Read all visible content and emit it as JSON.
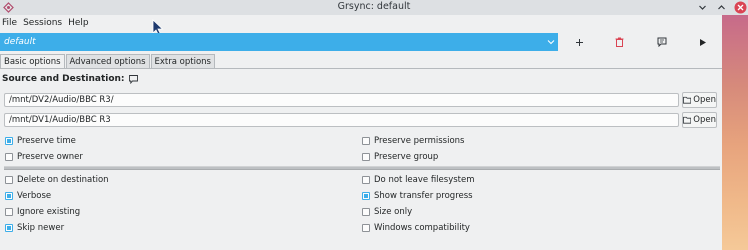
{
  "window": {
    "title": "Grsync: default",
    "controls": [
      "chevron-down-icon",
      "chevron-up-icon",
      "close-icon"
    ]
  },
  "menubar": {
    "items": [
      "File",
      "Sessions",
      "Help"
    ]
  },
  "session": {
    "selected": "default",
    "toolbar_icons": [
      "add-icon",
      "delete-icon",
      "comment-icon",
      "play-icon"
    ]
  },
  "tabs": [
    {
      "label": "Basic options",
      "active": true
    },
    {
      "label": "Advanced options",
      "active": false
    },
    {
      "label": "Extra options",
      "active": false
    }
  ],
  "source_destination": {
    "title": "Source and Destination:",
    "source_path": "/mnt/DV2/Audio/BBC R3/",
    "destination_path": "/mnt/DV1/Audio/BBC R3",
    "open_label": "Open"
  },
  "options_top": [
    {
      "label": "Preserve time",
      "checked": true
    },
    {
      "label": "Preserve permissions",
      "checked": false
    },
    {
      "label": "Preserve owner",
      "checked": false
    },
    {
      "label": "Preserve group",
      "checked": false
    }
  ],
  "options_bottom": [
    {
      "label": "Delete on destination",
      "checked": false
    },
    {
      "label": "Do not leave filesystem",
      "checked": false
    },
    {
      "label": "Verbose",
      "checked": true
    },
    {
      "label": "Show transfer progress",
      "checked": true
    },
    {
      "label": "Ignore existing",
      "checked": false
    },
    {
      "label": "Size only",
      "checked": false
    },
    {
      "label": "Skip newer",
      "checked": true
    },
    {
      "label": "Windows compatibility",
      "checked": false
    }
  ],
  "colors": {
    "accent": "#3daee9",
    "window_bg": "#eff0f1",
    "delete": "#da4453"
  }
}
